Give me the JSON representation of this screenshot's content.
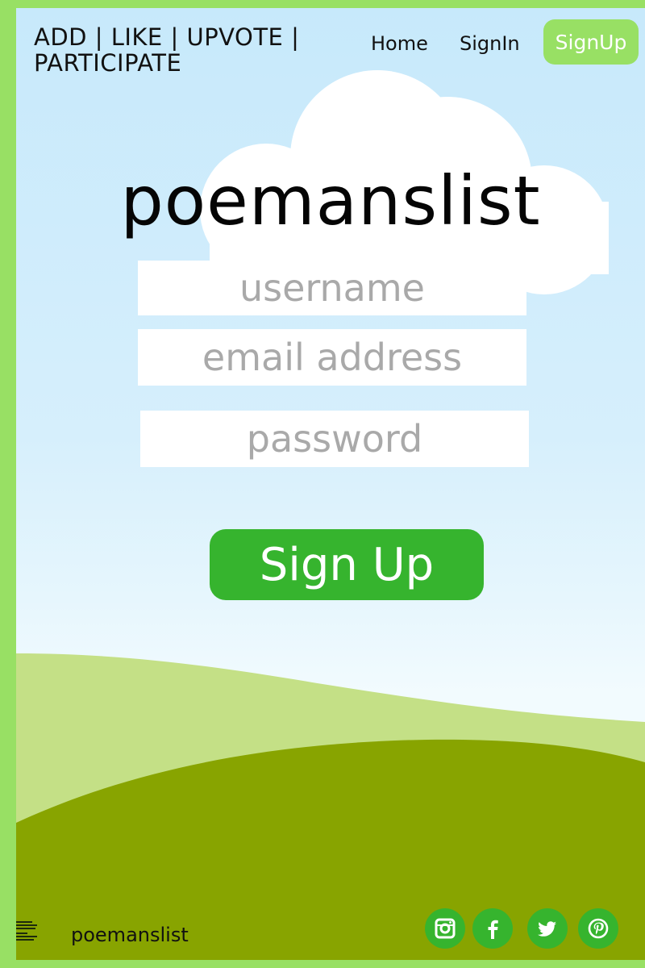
{
  "header": {
    "tagline": "ADD | LIKE | UPVOTE | PARTICIPATE",
    "nav": {
      "home": "Home",
      "signin": "SignIn",
      "signup": "SignUp"
    }
  },
  "form": {
    "title": "poemanslist",
    "username_placeholder": "username",
    "email_placeholder": "email address",
    "password_placeholder": "password",
    "submit_label": "Sign Up"
  },
  "footer": {
    "brand": "poemanslist",
    "social": [
      "instagram-icon",
      "facebook-icon",
      "twitter-icon",
      "pinterest-icon"
    ]
  },
  "colors": {
    "frame": "#98e064",
    "button": "#36b42e",
    "sky": "#c7e9fb",
    "hill_light": "#c4e086",
    "hill_dark": "#88a400"
  }
}
